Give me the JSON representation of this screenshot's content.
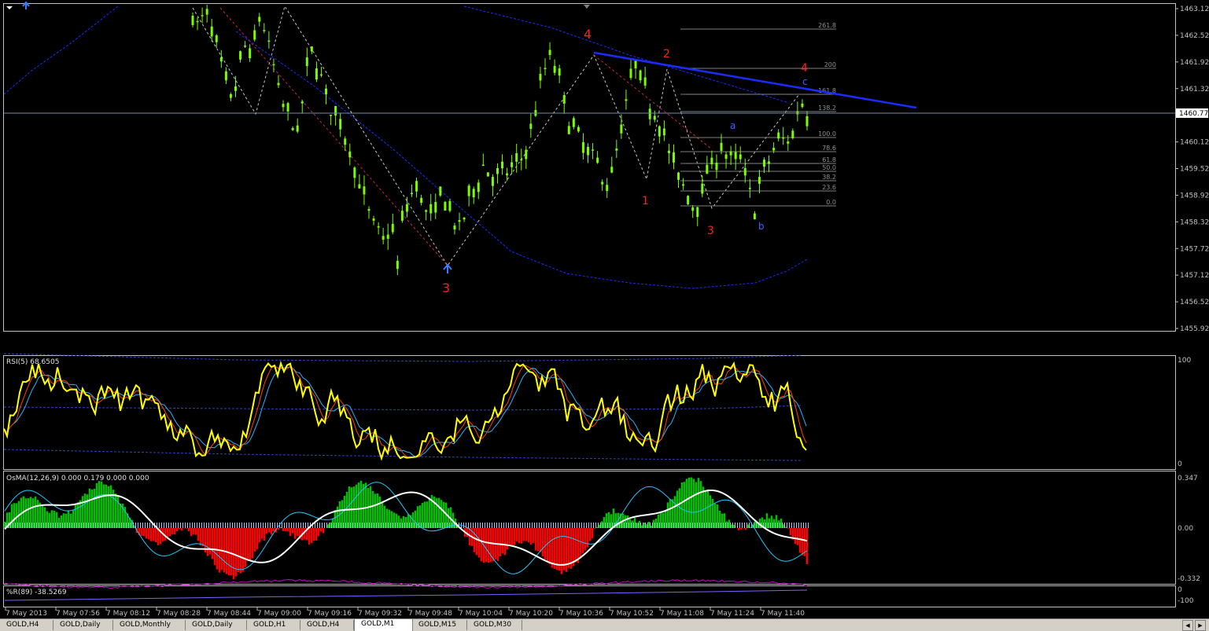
{
  "colors": {
    "background": "#000000",
    "candle": "#7CFC00",
    "wave_label": "#ff2020",
    "abc_label": "#4060ff",
    "trendline": "#1a2cff",
    "envelope": "#1a2cff",
    "rsi": "#ffff00",
    "rsi_ma_fast": "#ff4000",
    "rsi_ma_slow": "#22b5ff",
    "osma_up": "#00c000",
    "osma_down": "#ff0000",
    "osma_neutral": "#c0c0ff",
    "williams_line": "#cc00cc",
    "fib": "#808080"
  },
  "chart_data": [
    {
      "type": "candlestick",
      "name": "price",
      "ylim": [
        1455.65,
        1463.25
      ],
      "y_ticks": [
        "1463.12",
        "1462.52",
        "1461.92",
        "1461.32",
        "1460.72",
        "1460.12",
        "1459.52",
        "1458.92",
        "1458.32",
        "1457.72",
        "1457.12",
        "1456.52",
        "1455.92"
      ],
      "current_price": "1460.77",
      "close_path": [
        1462.9,
        1462.7,
        1463.1,
        1462.6,
        1462.0,
        1461.4,
        1461.0,
        1461.8,
        1462.3,
        1462.0,
        1463.0,
        1462.6,
        1462.0,
        1461.3,
        1460.8,
        1460.6,
        1460.3,
        1461.5,
        1462.2,
        1461.8,
        1461.3,
        1460.8,
        1460.6,
        1460.3,
        1459.8,
        1459.3,
        1458.8,
        1458.4,
        1458.1,
        1457.9,
        1458.3,
        1457.4,
        1458.6,
        1458.9,
        1459.2,
        1458.6,
        1458.4,
        1458.7,
        1459.0,
        1458.5,
        1458.1,
        1458.4,
        1458.9,
        1459.2,
        1459.6,
        1459.4,
        1459.3,
        1459.4,
        1459.5,
        1459.6,
        1459.8,
        1460.2,
        1461.0,
        1461.6,
        1462.1,
        1461.8,
        1461.2,
        1460.6,
        1460.3,
        1460.1,
        1459.9,
        1459.7,
        1459.3,
        1459.2,
        1459.8,
        1460.5,
        1461.3,
        1461.9,
        1461.5,
        1461.0,
        1460.8,
        1460.5,
        1459.9,
        1459.5,
        1459.2,
        1458.9,
        1458.6,
        1459.0,
        1459.5,
        1459.7,
        1460.0,
        1459.8,
        1459.6,
        1459.8,
        1459.2,
        1458.6,
        1459.3,
        1459.6,
        1460.0,
        1460.2,
        1460.1,
        1460.4,
        1461.1,
        1460.8
      ]
    },
    {
      "type": "line",
      "name": "RSI(5)",
      "value": "68.6505",
      "label": "RSI(5) 68.6505",
      "ylim": [
        0,
        100
      ],
      "y_ticks": [
        "100",
        "0"
      ]
    },
    {
      "type": "bar",
      "name": "OsMA(12,26,9)",
      "label": "OsMA(12,26,9) 0.000 0.179 0.000 0.000",
      "ylim": [
        -0.35,
        0.347
      ],
      "y_ticks": [
        "0.347",
        "0.00",
        "-0.332"
      ]
    },
    {
      "type": "line",
      "name": "%R(89)",
      "value": "-38.5269",
      "label": "%R(89) -38.5269",
      "ylim": [
        -100,
        0
      ],
      "y_ticks": [
        "0",
        "-100"
      ]
    }
  ],
  "time_axis": [
    "7 May 2013",
    "7 May 07:56",
    "7 May 08:12",
    "7 May 08:28",
    "7 May 08:44",
    "7 May 09:00",
    "7 May 09:16",
    "7 May 09:32",
    "7 May 09:48",
    "7 May 10:04",
    "7 May 10:20",
    "7 May 10:36",
    "7 May 10:52",
    "7 May 11:08",
    "7 May 11:24",
    "7 May 11:40"
  ],
  "fib_levels": [
    "261.8",
    "200",
    "161.8",
    "138.2",
    "100.0",
    "78.6",
    "61.8",
    "50.0",
    "38.2",
    "23.6",
    "0.0"
  ],
  "wave_labels": {
    "w4a": "4",
    "w3": "3",
    "w2": "2",
    "w1": "1",
    "w3b": "3",
    "w4b": "4",
    "a": "a",
    "b": "b",
    "c": "c"
  },
  "tabs": [
    {
      "label": "GOLD,H4",
      "active": false
    },
    {
      "label": "GOLD,Daily",
      "active": false
    },
    {
      "label": "GOLD,Monthly",
      "active": false
    },
    {
      "label": "GOLD,Daily",
      "active": false
    },
    {
      "label": "GOLD,H1",
      "active": false
    },
    {
      "label": "GOLD,H4",
      "active": false
    },
    {
      "label": "GOLD,M1",
      "active": true
    },
    {
      "label": "GOLD,M15",
      "active": false
    },
    {
      "label": "GOLD,M30",
      "active": false
    }
  ]
}
